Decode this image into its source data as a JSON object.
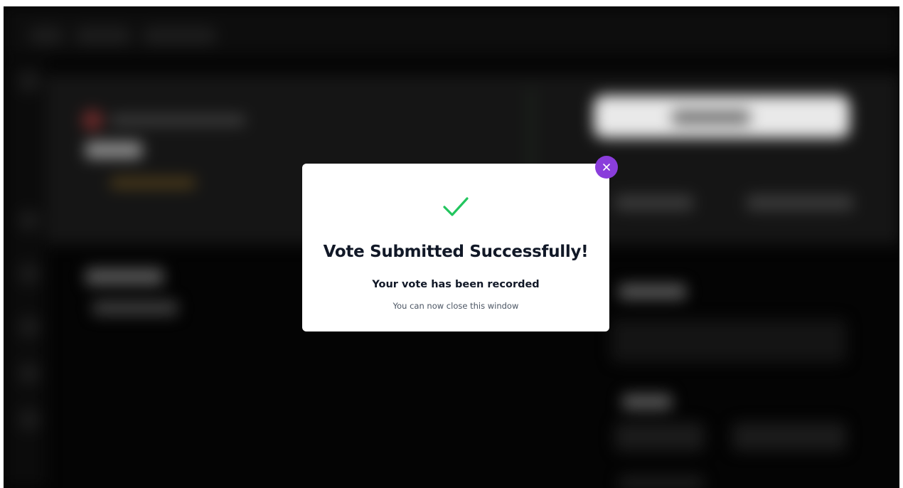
{
  "modal": {
    "title": "Vote Submitted Successfully!",
    "subtitle": "Your vote has been recorded",
    "hint": "You can now close this window",
    "status_icon": "check-icon",
    "close_icon": "close-icon"
  },
  "colors": {
    "success_green": "#22c55e",
    "close_button_purple": "#8a3ddb",
    "overlay_background": "#040404",
    "modal_background": "#ffffff"
  }
}
